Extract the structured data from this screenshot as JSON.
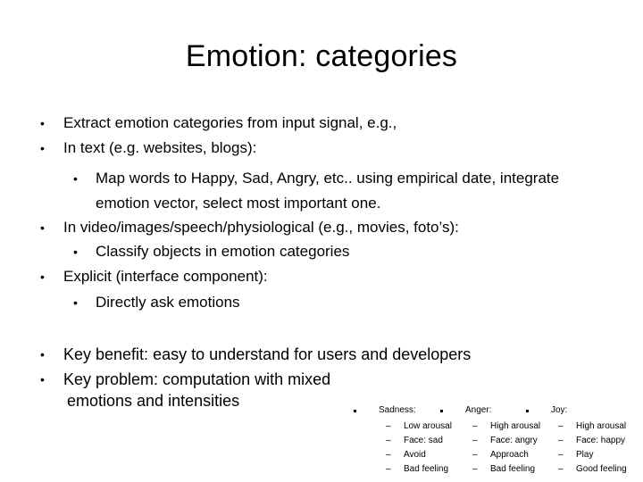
{
  "slide": {
    "title": "Emotion: categories",
    "bullets": [
      {
        "level": 1,
        "text": "Extract emotion categories from input signal, e.g.,"
      },
      {
        "level": 1,
        "text": "In text (e.g. websites, blogs):"
      },
      {
        "level": 2,
        "text": "Map words to Happy, Sad, Angry, etc.. using empirical date, integrate"
      },
      {
        "level": 2,
        "text": "emotion vector, select most important one.",
        "continuation": true
      },
      {
        "level": 1,
        "text": "In video/images/speech/physiological (e.g., movies, foto’s):"
      },
      {
        "level": 2,
        "text": "Classify objects in emotion categories"
      },
      {
        "level": 1,
        "text": "Explicit (interface component):"
      },
      {
        "level": 2,
        "text": "Directly ask emotions"
      },
      {
        "level": 1,
        "text": "Key benefit: easy to understand for users and developers"
      },
      {
        "level": 1,
        "text": "Key problem: computation with mixed"
      },
      {
        "level": 1,
        "text": "emotions and intensities",
        "continuation": true
      }
    ],
    "bullet_glyph": "•",
    "dash_glyph": "–",
    "emotions": [
      {
        "name": "Sadness:",
        "traits": [
          "Low arousal",
          "Face: sad",
          "Avoid",
          "Bad feeling"
        ]
      },
      {
        "name": "Anger:",
        "traits": [
          "High arousal",
          "Face: angry",
          "Approach",
          "Bad feeling"
        ]
      },
      {
        "name": "Joy:",
        "traits": [
          "High arousal",
          "Face: happy",
          "Play",
          "Good feeling"
        ]
      }
    ]
  }
}
